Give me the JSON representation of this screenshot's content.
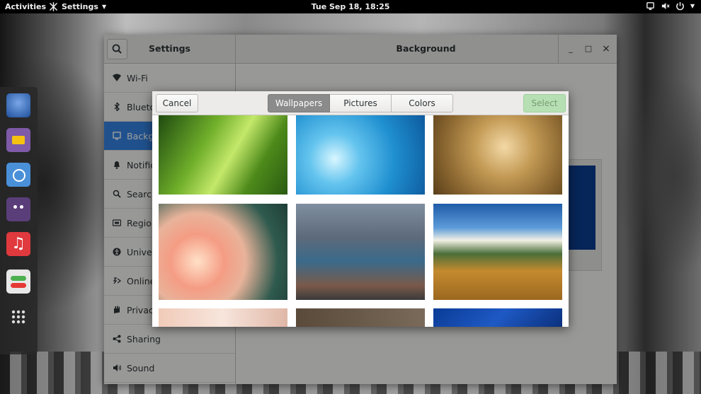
{
  "topbar": {
    "activities": "Activities",
    "app_menu": "Settings",
    "clock": "Tue Sep 18, 18:25"
  },
  "dash": {
    "apps": [
      "thunderbird-icon",
      "files-icon",
      "chromium-icon",
      "hexchat-icon",
      "rhythmbox-icon",
      "settings-icon",
      "show-apps-icon"
    ]
  },
  "settings": {
    "sidebar_title": "Settings",
    "page_title": "Background",
    "sidebar": [
      {
        "label": "Wi-Fi",
        "icon": "wifi-icon"
      },
      {
        "label": "Blueto",
        "icon": "bluetooth-icon"
      },
      {
        "label": "Backgr",
        "icon": "background-icon"
      },
      {
        "label": "Notifica",
        "icon": "notifications-icon"
      },
      {
        "label": "Search",
        "icon": "search-icon"
      },
      {
        "label": "Region",
        "icon": "region-icon"
      },
      {
        "label": "Univers",
        "icon": "universal-access-icon"
      },
      {
        "label": "Online",
        "icon": "online-accounts-icon"
      },
      {
        "label": "Privacy",
        "icon": "privacy-icon"
      },
      {
        "label": "Sharing",
        "icon": "sharing-icon"
      },
      {
        "label": "Sound",
        "icon": "sound-icon"
      }
    ],
    "window_buttons": {
      "minimize": "_",
      "maximize": "□",
      "close": "×"
    }
  },
  "dialog": {
    "cancel": "Cancel",
    "select": "Select",
    "tabs": [
      "Wallpapers",
      "Pictures",
      "Colors"
    ],
    "active_tab": "Wallpapers"
  }
}
